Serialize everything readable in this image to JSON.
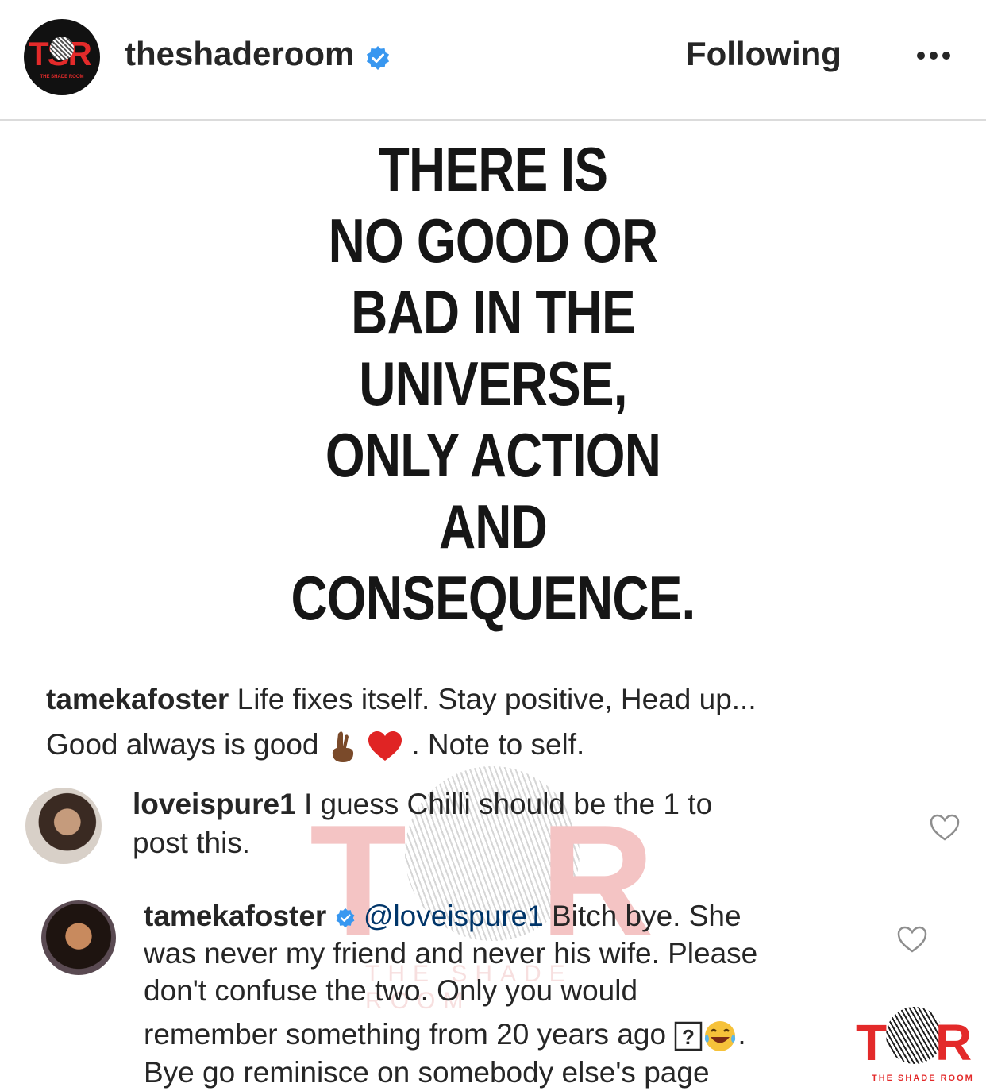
{
  "header": {
    "username": "theshaderoom",
    "follow_state": "Following",
    "avatar_logo_text": "TSR",
    "avatar_logo_tag": "THE SHADE ROOM"
  },
  "post": {
    "quote_lines": [
      "THERE IS",
      "NO GOOD OR",
      "BAD IN THE",
      "UNIVERSE,",
      "ONLY ACTION",
      "AND",
      "CONSEQUENCE."
    ]
  },
  "caption": {
    "author": "tamekafoster",
    "text_line1": "Life fixes itself. Stay positive, Head up...",
    "text_line2a": "Good always is good",
    "text_line2b": ". Note to self."
  },
  "comments": [
    {
      "author": "loveispure1",
      "lines": [
        "I guess Chilli should be the 1 to",
        "post this."
      ]
    },
    {
      "author": "tamekafoster",
      "mention": "@loveispure1",
      "line1_rest": "Bitch bye. She",
      "lines": [
        "was never my friend and never his wife. Please",
        "don't confuse the two. Only you would"
      ],
      "line4a": "remember something from 20 years ago",
      "line4b": ".",
      "line5": "Bye go reminisce on somebody else's page"
    }
  ],
  "watermark": {
    "text": "TSR",
    "tag": "THE SHADE ROOM"
  },
  "colors": {
    "brand_red": "#e32a2a",
    "verified_blue": "#3897f0"
  },
  "icons": [
    "verified-badge-icon",
    "more-options-icon",
    "heart-icon",
    "crossed-fingers-emoji",
    "red-heart-emoji",
    "unknown-glyph-icon",
    "laughing-tears-emoji"
  ]
}
